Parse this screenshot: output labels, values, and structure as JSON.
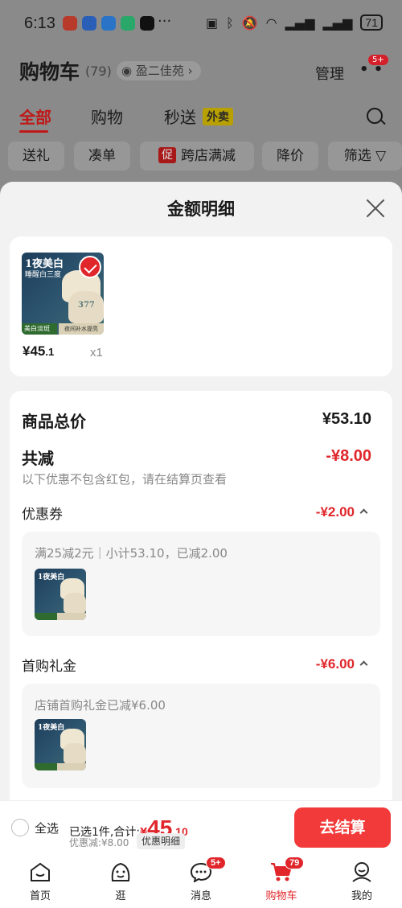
{
  "status_bar": {
    "time": "6:13",
    "more": "···",
    "battery": "71"
  },
  "header": {
    "title": "购物车",
    "count": "(79)",
    "location": "盈二佳苑",
    "manage": "管理",
    "more_badge": "5+"
  },
  "tabs": [
    {
      "label": "全部"
    },
    {
      "label": "购物"
    },
    {
      "label": "秒送"
    }
  ],
  "waimai_tag": "外卖",
  "filters": [
    {
      "label": "送礼"
    },
    {
      "label": "凑单"
    },
    {
      "tag": "促",
      "label": "跨店满减"
    },
    {
      "label": "降价"
    },
    {
      "label": "筛选"
    }
  ],
  "sheet": {
    "title": "金额明细",
    "product": {
      "image_text": "1夜美白",
      "image_sub": "睡醒白三度",
      "image_num": "377",
      "image_band": "美白淡斑",
      "image_band2": "夜间补水提亮",
      "price_int": "¥45",
      "price_dec": ".1",
      "qty": "x1"
    },
    "total_label": "商品总价",
    "total_value": "¥53.10",
    "reduce_label": "共减",
    "reduce_value": "-¥8.00",
    "reduce_note": "以下优惠不包含红包，请在结算页查看",
    "coupon": {
      "label": "优惠券",
      "value": "-¥2.00",
      "detail": "满25减2元｜小计53.10，已减2.00"
    },
    "gift": {
      "label": "首购礼金",
      "value": "-¥6.00",
      "detail": "店铺首购礼金已减¥6.00"
    }
  },
  "checkout": {
    "select_all": "全选",
    "selected_text": "已选1件,合计:",
    "yen": "¥",
    "total_int": "45",
    "total_dec": ".10",
    "discount_text": "优惠减:¥8.00",
    "detail_button": "优惠明细",
    "pay_button": "去结算"
  },
  "tabbar": [
    {
      "label": "首页",
      "icon": "home-icon"
    },
    {
      "label": "逛",
      "icon": "explore-icon"
    },
    {
      "label": "消息",
      "icon": "message-icon",
      "badge": "5+"
    },
    {
      "label": "购物车",
      "icon": "cart-icon",
      "badge": "79"
    },
    {
      "label": "我的",
      "icon": "profile-icon"
    }
  ],
  "colors": {
    "accent": "#e0262b",
    "pay_button": "#f23a3a"
  }
}
